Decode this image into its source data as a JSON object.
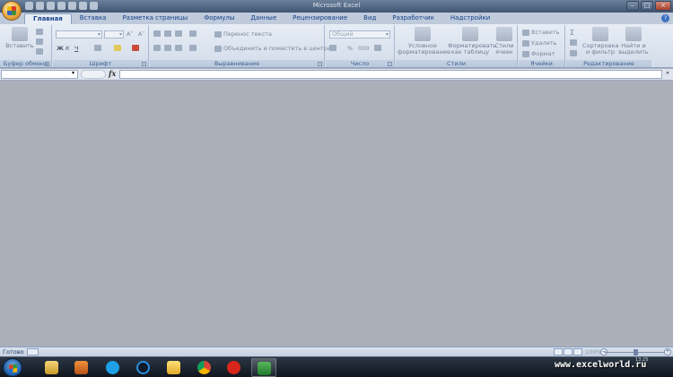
{
  "window": {
    "title": "Microsoft Excel"
  },
  "tabs": [
    "Главная",
    "Вставка",
    "Разметка страницы",
    "Формулы",
    "Данные",
    "Рецензирование",
    "Вид",
    "Разработчик",
    "Надстройки"
  ],
  "ribbon": {
    "clipboard": {
      "label": "Буфер обмена",
      "paste": "Вставить"
    },
    "font": {
      "label": "Шрифт",
      "bold": "Ж",
      "italic": "К",
      "underline": "Ч",
      "grow": "A˄",
      "shrink": "A˅"
    },
    "alignment": {
      "label": "Выравнивание",
      "wrap": "Перенос текста",
      "merge": "Объединить и поместить в центре"
    },
    "number": {
      "label": "Число",
      "format": "Общий",
      "percent": "%",
      "thousands": "000"
    },
    "styles": {
      "label": "Стили",
      "conditional": "Условное форматирование",
      "as_table": "Форматировать как таблицу",
      "cell_styles": "Стили ячеек"
    },
    "cells": {
      "label": "Ячейки",
      "insert": "Вставить",
      "delete": "Удалить",
      "format": "Формат"
    },
    "editing": {
      "label": "Редактирование",
      "sigma": "Σ",
      "sort": "Сортировка и фильтр",
      "find": "Найти и выделить"
    }
  },
  "formula_bar": {
    "fx": "fx",
    "namebox_value": "",
    "formula_value": ""
  },
  "status": {
    "text": "Готово",
    "zoom": "100%"
  },
  "taskbar": {
    "watermark": "www.excelworld.ru",
    "time": "13:25"
  },
  "colors": {
    "accent": "#15428b",
    "workspace": "#abafb8",
    "ribbon": "#dde5f0",
    "taskbar": "#1b232e"
  }
}
